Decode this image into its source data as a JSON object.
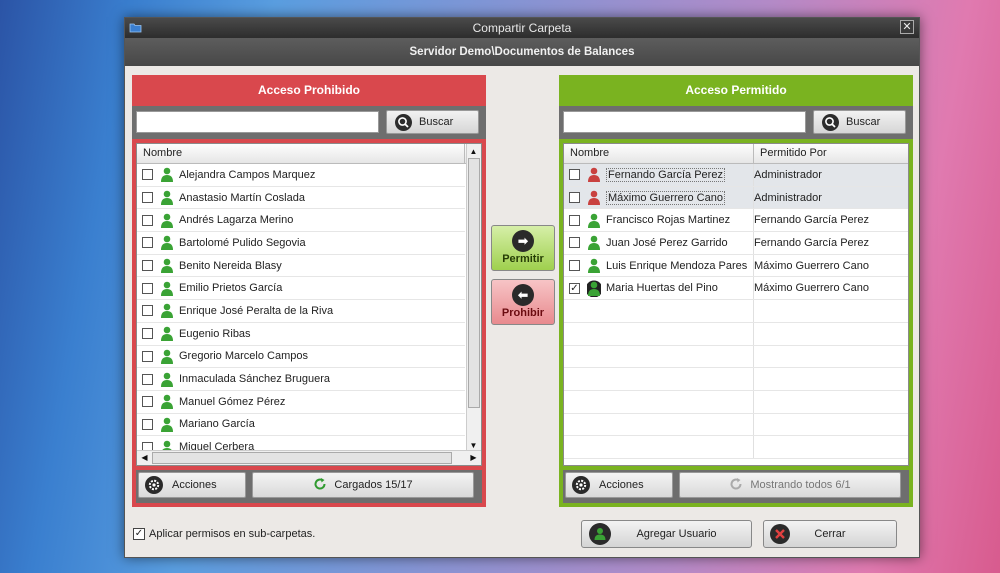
{
  "window": {
    "title": "Compartir Carpeta",
    "close_glyph": "✕",
    "path": "Servidor Demo\\Documentos de Balances"
  },
  "icons": {
    "app": "folder-share-icon",
    "search": "search-icon",
    "gear": "gear-icon",
    "refresh": "refresh-icon",
    "user_green": "user-green-icon",
    "user_red": "user-red-icon"
  },
  "colors": {
    "denied": "#d9484d",
    "allowed": "#7ab320",
    "user_green": "#3aa335",
    "user_red": "#c9413f"
  },
  "left": {
    "title": "Acceso Prohibido",
    "search_value": "",
    "search_button": "Buscar",
    "column_header": "Nombre",
    "rows": [
      {
        "name": "Alejandra Campos Marquez",
        "checked": false
      },
      {
        "name": "Anastasio Martín Coslada",
        "checked": false
      },
      {
        "name": "Andrés Lagarza Merino",
        "checked": false
      },
      {
        "name": "Bartolomé Pulido Segovia",
        "checked": false
      },
      {
        "name": "Benito Nereida Blasy",
        "checked": false
      },
      {
        "name": "Emilio Prietos García",
        "checked": false
      },
      {
        "name": "Enrique José Peralta de la Riva",
        "checked": false
      },
      {
        "name": "Eugenio Ribas",
        "checked": false
      },
      {
        "name": "Gregorio Marcelo Campos",
        "checked": false
      },
      {
        "name": "Inmaculada Sánchez Bruguera",
        "checked": false
      },
      {
        "name": "Manuel Gómez Pérez",
        "checked": false
      },
      {
        "name": "Mariano García",
        "checked": false
      },
      {
        "name": "Miguel Cerbera",
        "checked": false
      }
    ],
    "actions_button": "Acciones",
    "status_button": "Cargados 15/17"
  },
  "middle": {
    "allow_button": "Permitir",
    "deny_button": "Prohibir",
    "allow_glyph": "➡",
    "deny_glyph": "⬅"
  },
  "right": {
    "title": "Acceso Permitido",
    "search_value": "",
    "search_button": "Buscar",
    "column_headers": [
      "Nombre",
      "Permitido Por"
    ],
    "rows": [
      {
        "name": "Fernando García Perez",
        "by": "Administrador",
        "checked": false,
        "icon": "user-red-icon",
        "highlight": true
      },
      {
        "name": "Máximo Guerrero Cano",
        "by": "Administrador",
        "checked": false,
        "icon": "user-red-icon",
        "highlight": true
      },
      {
        "name": "Francisco Rojas Martinez",
        "by": "Fernando García Perez",
        "checked": false,
        "icon": "user-green-icon",
        "highlight": false
      },
      {
        "name": "Juan José Perez Garrido",
        "by": "Fernando García Perez",
        "checked": false,
        "icon": "user-green-icon",
        "highlight": false
      },
      {
        "name": "Luis Enrique Mendoza Pares",
        "by": "Máximo Guerrero Cano",
        "checked": false,
        "icon": "user-green-icon",
        "highlight": false
      },
      {
        "name": "Maria Huertas del Pino",
        "by": "Máximo Guerrero Cano",
        "checked": true,
        "icon": "user-green-icon",
        "highlight": false
      }
    ],
    "actions_button": "Acciones",
    "status_button": "Mostrando todos 6/1"
  },
  "footer": {
    "subfolders_label": "Aplicar permisos en sub-carpetas.",
    "subfolders_checked": true,
    "add_user_button": "Agregar Usuario",
    "close_button": "Cerrar",
    "check_glyph": "✓",
    "close_glyph": "✕"
  }
}
